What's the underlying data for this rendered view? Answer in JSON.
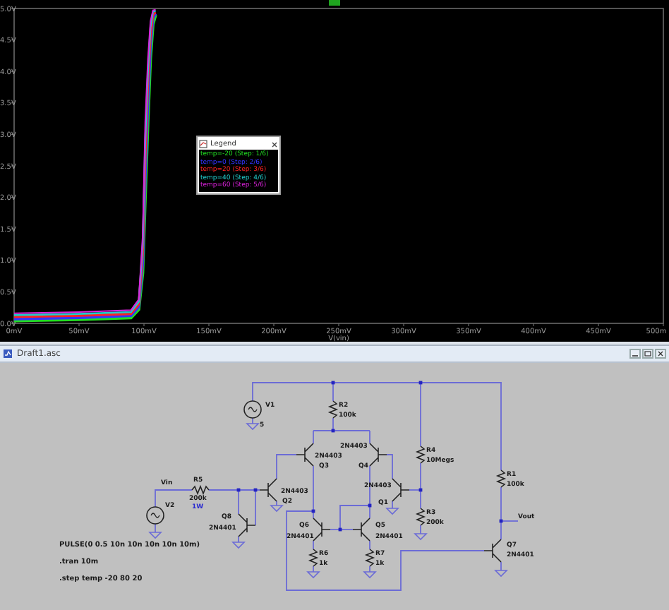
{
  "plot_window": {
    "chart_data": {
      "type": "line",
      "xlabel": "V(vin)",
      "x": [
        0,
        50,
        90,
        96,
        99,
        101,
        103,
        105,
        107,
        109
      ],
      "series": [
        {
          "name": "temp=-20 (Step: 1/6)",
          "color": "#22dd22",
          "values": [
            0.04,
            0.06,
            0.09,
            0.22,
            0.8,
            2.0,
            3.2,
            4.2,
            4.75,
            4.9
          ]
        },
        {
          "name": "temp=0 (Step: 2/6)",
          "color": "#3333ff",
          "values": [
            0.07,
            0.09,
            0.12,
            0.26,
            0.95,
            2.3,
            3.5,
            4.4,
            4.85,
            4.92
          ]
        },
        {
          "name": "temp=20 (Step: 3/6)",
          "color": "#ff2222",
          "values": [
            0.1,
            0.12,
            0.15,
            0.3,
            1.1,
            2.6,
            3.8,
            4.55,
            4.9,
            4.94
          ]
        },
        {
          "name": "temp=40 (Step: 4/6)",
          "color": "#22cccc",
          "values": [
            0.13,
            0.15,
            0.18,
            0.34,
            1.25,
            2.9,
            4.0,
            4.7,
            4.95,
            4.96
          ]
        },
        {
          "name": "temp=60 (Step: 5/6)",
          "color": "#dd22dd",
          "values": [
            0.16,
            0.18,
            0.21,
            0.38,
            1.4,
            3.2,
            4.2,
            4.8,
            4.97,
            4.98
          ]
        }
      ],
      "xlim": [
        0,
        500
      ],
      "ylim": [
        0,
        5
      ],
      "xticks": [
        {
          "value": 0,
          "label": "0mV"
        },
        {
          "value": 50,
          "label": "50mV"
        },
        {
          "value": 100,
          "label": "100mV"
        },
        {
          "value": 150,
          "label": "150mV"
        },
        {
          "value": 200,
          "label": "200mV"
        },
        {
          "value": 250,
          "label": "250mV"
        },
        {
          "value": 300,
          "label": "300mV"
        },
        {
          "value": 350,
          "label": "350mV"
        },
        {
          "value": 400,
          "label": "400mV"
        },
        {
          "value": 450,
          "label": "450mV"
        },
        {
          "value": 500,
          "label": "500m"
        }
      ],
      "yticks": [
        {
          "value": 0,
          "label": "0.0V"
        },
        {
          "value": 0.5,
          "label": "0.5V"
        },
        {
          "value": 1,
          "label": "1.0V"
        },
        {
          "value": 1.5,
          "label": "1.5V"
        },
        {
          "value": 2,
          "label": "2.0V"
        },
        {
          "value": 2.5,
          "label": "2.5V"
        },
        {
          "value": 3,
          "label": "3.0V"
        },
        {
          "value": 3.5,
          "label": "3.5V"
        },
        {
          "value": 4,
          "label": "4.0V"
        },
        {
          "value": 4.5,
          "label": "4.5V"
        },
        {
          "value": 5,
          "label": "5.0V"
        }
      ]
    },
    "legend": {
      "title": "Legend"
    }
  },
  "schematic_window": {
    "title": "Draft1.asc",
    "components": [
      {
        "kind": "source",
        "ref": "V1",
        "value": "5"
      },
      {
        "kind": "resistor",
        "ref": "R2",
        "value": "100k"
      },
      {
        "kind": "transistor",
        "ref": "Q3",
        "value": "2N4403"
      },
      {
        "kind": "transistor",
        "ref": "Q4",
        "value": "2N4403"
      },
      {
        "kind": "resistor",
        "ref": "R4",
        "value": "10Megs"
      },
      {
        "kind": "resistor",
        "ref": "R1",
        "value": "100k"
      },
      {
        "kind": "source",
        "ref": "V2"
      },
      {
        "kind": "resistor",
        "ref": "R5",
        "value": "200k",
        "rating": "1W"
      },
      {
        "kind": "transistor",
        "ref": "Q2",
        "value": "2N4403"
      },
      {
        "kind": "transistor",
        "ref": "Q1",
        "value": "2N4403"
      },
      {
        "kind": "resistor",
        "ref": "R3",
        "value": "200k"
      },
      {
        "kind": "transistor",
        "ref": "Q8",
        "value": "2N4401"
      },
      {
        "kind": "transistor",
        "ref": "Q6",
        "value": "2N4401"
      },
      {
        "kind": "transistor",
        "ref": "Q5",
        "value": "2N4401"
      },
      {
        "kind": "transistor",
        "ref": "Q7",
        "value": "2N4401"
      },
      {
        "kind": "resistor",
        "ref": "R6",
        "value": "1k"
      },
      {
        "kind": "resistor",
        "ref": "R7",
        "value": "1k"
      }
    ],
    "net_labels": [
      "Vin",
      "Vout"
    ],
    "directives": [
      "PULSE(0 0.5 10n 10n 10n 10n 10m)",
      ".tran 10m",
      ".step temp -20 80 20"
    ]
  }
}
